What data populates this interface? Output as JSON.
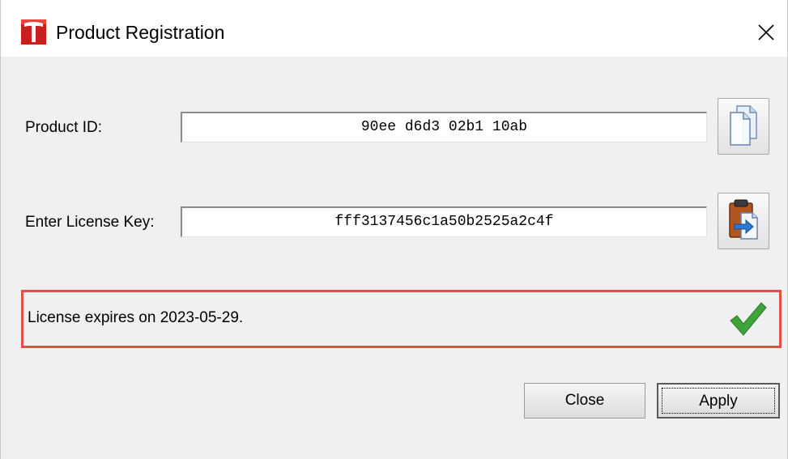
{
  "window": {
    "title": "Product Registration",
    "app_icon": "tesla-t-logo-icon",
    "close_icon": "close-icon"
  },
  "form": {
    "product_id_label": "Product ID:",
    "product_id_value": "90ee d6d3 02b1 10ab",
    "license_key_label": "Enter License Key:",
    "license_key_value": "fff3137456c1a50b2525a2c4f",
    "copy_button_icon": "copy-documents-icon",
    "paste_button_icon": "paste-clipboard-icon"
  },
  "status": {
    "message": "License expires on 2023-05-29.",
    "icon": "checkmark-icon",
    "border_color": "#e0504a",
    "check_color": "#3ea43a"
  },
  "buttons": {
    "close_label": "Close",
    "apply_label": "Apply"
  }
}
